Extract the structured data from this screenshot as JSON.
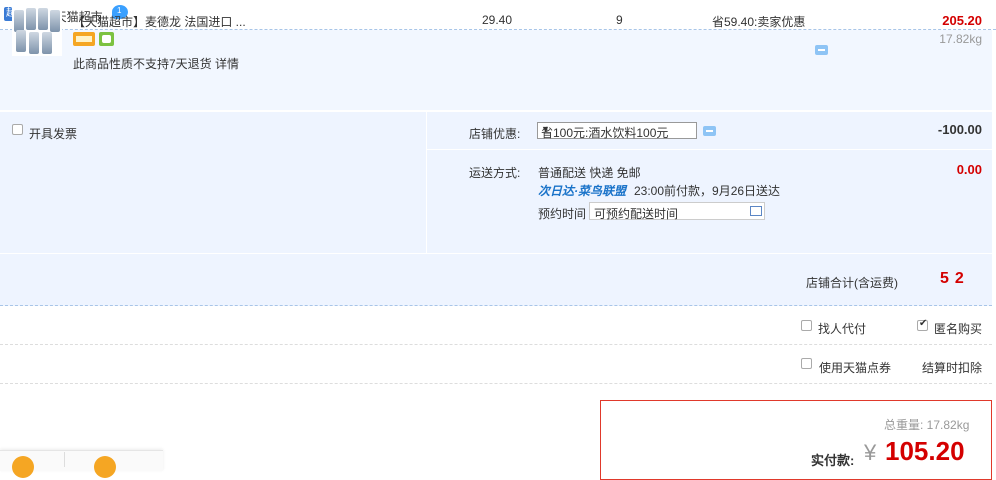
{
  "shop": {
    "badge": "超",
    "title": "店铺: 天猫超市",
    "ww_count": "1"
  },
  "item": {
    "name": "【天猫超市】麦德龙 法国进口 ...",
    "note": "此商品性质不支持7天退货 详情",
    "price": "29.40",
    "quantity": "9",
    "saving": "省59.40:卖家优惠",
    "subtotal": "205.20",
    "weight": "17.82kg"
  },
  "options": {
    "invoice_label": "开具发票",
    "promo_label": "店铺优惠:",
    "promo_selected": "省100元:酒水饮料100元",
    "promo_amount": "-100.00",
    "shipping_label": "运送方式:",
    "shipping_method": "普通配送 快递 免邮",
    "logistics_logo": "次日达·菜鸟联盟",
    "logistics_info": "23:00前付款，9月26日送达",
    "shipping_amount": "0.00",
    "appointment_label": "预约时间",
    "appointment_placeholder": "可预约配送时间",
    "store_total_label": "店铺合计(含运费)",
    "store_total_value": "52"
  },
  "extras": {
    "agent_pay_label": "找人代付",
    "anonymous_label": "匿名购买",
    "anonymous_checked": true,
    "points_label": "使用天猫点券",
    "points_note": "结算时扣除"
  },
  "summary": {
    "total_weight": "总重量: 17.82kg",
    "pay_label": "实付款:",
    "currency": "¥",
    "pay_value": "105.20"
  },
  "colors": {
    "accent_red": "#d40000",
    "row_bg": "#f2f7ff",
    "options_bg": "#eef4ff",
    "summary_border": "#e0392b"
  }
}
